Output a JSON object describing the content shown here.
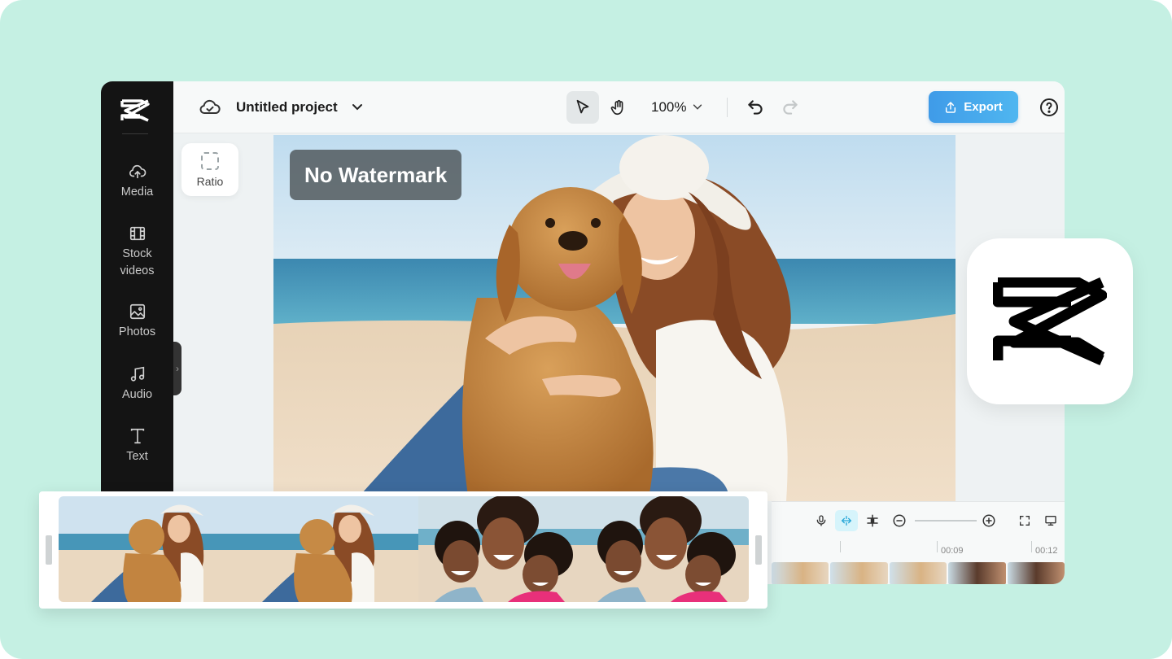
{
  "app": {
    "name": "CapCut"
  },
  "sidebar": {
    "items": [
      {
        "label": "Media",
        "icon": "cloud-upload-icon"
      },
      {
        "label": "Stock\nvideos",
        "icon": "film-icon"
      },
      {
        "label": "Photos",
        "icon": "image-icon"
      },
      {
        "label": "Audio",
        "icon": "music-note-icon"
      },
      {
        "label": "Text",
        "icon": "text-icon"
      }
    ]
  },
  "header": {
    "project_title": "Untitled project",
    "zoom": "100%",
    "export_label": "Export"
  },
  "tools": {
    "ratio_label": "Ratio"
  },
  "canvas": {
    "overlay_label": "No Watermark"
  },
  "timeline": {
    "ticks": [
      "00:09",
      "00:12"
    ]
  },
  "colors": {
    "background": "#c5f0e3",
    "sidebar": "#141414",
    "accent": "#45a8ec",
    "badge": "rgba(70,75,78,0.72)"
  }
}
